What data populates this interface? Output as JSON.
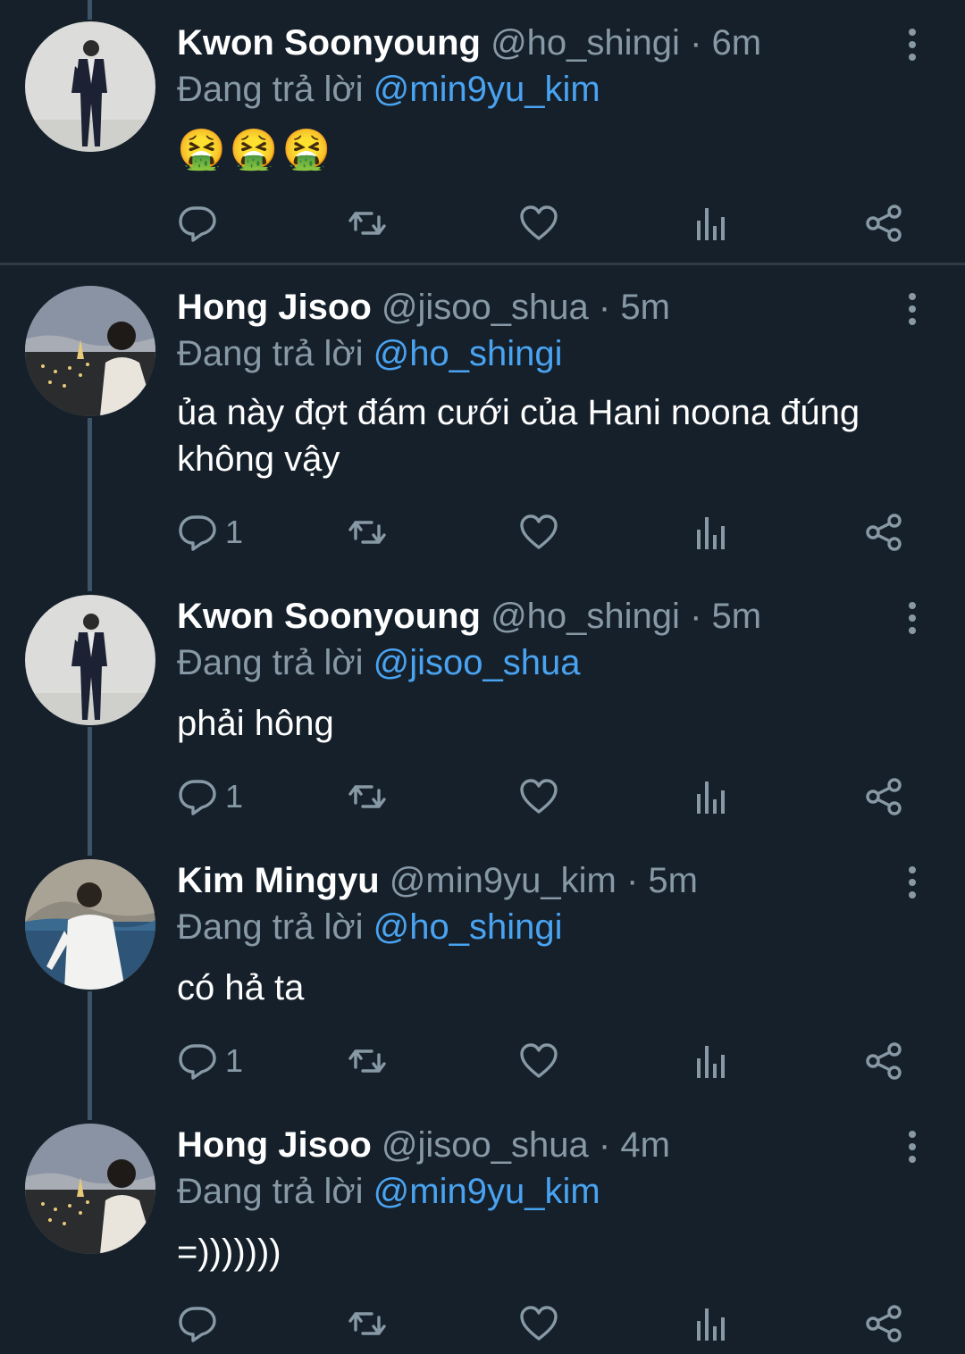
{
  "colors": {
    "background": "#15202b",
    "secondary_text": "#8899a6",
    "mention": "#4aa3f0",
    "thread_line": "#3d5466",
    "divider": "#2f3b47"
  },
  "tweets": [
    {
      "name": "Kwon Soonyoung",
      "handle": "@ho_shingi",
      "separator": "·",
      "time": "6m",
      "replying_label": "Đang trả lời",
      "replying_to": "@min9yu_kim",
      "text": "🤮🤮🤮",
      "reply_count": "",
      "avatar": "avatar-kwon-soonyoung"
    },
    {
      "name": "Hong Jisoo",
      "handle": "@jisoo_shua",
      "separator": "·",
      "time": "5m",
      "replying_label": "Đang trả lời",
      "replying_to": "@ho_shingi",
      "text": "ủa này đợt đám cưới của Hani noona đúng không vậy",
      "reply_count": "1",
      "avatar": "avatar-hong-jisoo"
    },
    {
      "name": "Kwon Soonyoung",
      "handle": "@ho_shingi",
      "separator": "·",
      "time": "5m",
      "replying_label": "Đang trả lời",
      "replying_to": "@jisoo_shua",
      "text": "phải hông",
      "reply_count": "1",
      "avatar": "avatar-kwon-soonyoung"
    },
    {
      "name": "Kim Mingyu",
      "handle": "@min9yu_kim",
      "separator": "·",
      "time": "5m",
      "replying_label": "Đang trả lời",
      "replying_to": "@ho_shingi",
      "text": "có hả ta",
      "reply_count": "1",
      "avatar": "avatar-kim-mingyu"
    },
    {
      "name": "Hong Jisoo",
      "handle": "@jisoo_shua",
      "separator": "·",
      "time": "4m",
      "replying_label": "Đang trả lời",
      "replying_to": "@min9yu_kim",
      "text": "=)))))))",
      "reply_count": "",
      "avatar": "avatar-hong-jisoo"
    }
  ],
  "icons": {
    "reply": "reply-icon",
    "retweet": "retweet-icon",
    "like": "heart-icon",
    "analytics": "analytics-icon",
    "share": "share-icon",
    "more": "more-vertical-icon"
  }
}
